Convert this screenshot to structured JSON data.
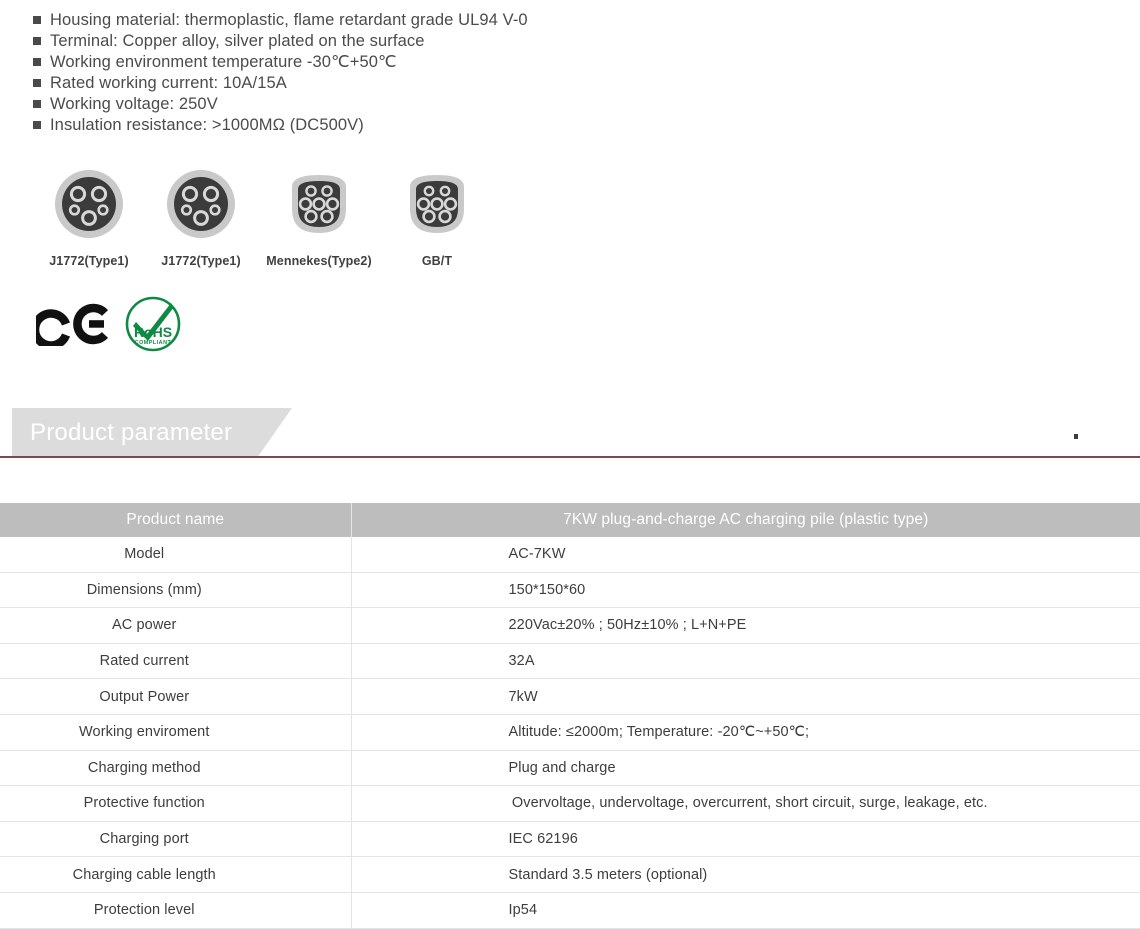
{
  "specs": {
    "bullet_glyph": "square-bullet",
    "items": [
      "Housing material: thermoplastic, flame retardant grade UL94 V-0",
      "Terminal: Copper alloy, silver plated on the surface",
      "Working environment temperature -30℃+50℃",
      "Rated working current: 10A/15A",
      "Working voltage: 250V",
      "Insulation resistance: >1000MΩ (DC500V)"
    ]
  },
  "connectors": [
    {
      "label": "J1772(Type1)",
      "icon": "j1772-type1-connector-icon",
      "shape": "circle",
      "pins": 5
    },
    {
      "label": "J1772(Type1)",
      "icon": "j1772-type1-connector-icon",
      "shape": "circle",
      "pins": 5
    },
    {
      "label": "Mennekes(Type2)",
      "icon": "mennekes-type2-connector-icon",
      "shape": "d-shape",
      "pins": 7
    },
    {
      "label": "GB/T",
      "icon": "gbt-connector-icon",
      "shape": "d-shape",
      "pins": 7
    }
  ],
  "certifications": [
    {
      "name": "ce-mark-logo",
      "label": "CE"
    },
    {
      "name": "rohs-compliant-logo",
      "label": "RoHS",
      "sublabel": "COMPLIANT"
    }
  ],
  "section": {
    "title": "Product parameter",
    "banner_color": "#dcdcdc",
    "rule_color": "#7d4a4a"
  },
  "table": {
    "header": {
      "col1": "Product name",
      "col2": "7KW plug-and-charge AC charging pile (plastic type)",
      "background": "#bdbdbd"
    },
    "rows": [
      {
        "key": "Model",
        "value": "AC-7KW",
        "wide": false
      },
      {
        "key": "Dimensions (mm)",
        "value": "150*150*60",
        "wide": false
      },
      {
        "key": "AC power",
        "value": "220Vac±20% ; 50Hz±10% ; L+N+PE",
        "wide": false
      },
      {
        "key": "Rated current",
        "value": "32A",
        "wide": false
      },
      {
        "key": "Output Power",
        "value": "7kW",
        "wide": false
      },
      {
        "key": "Working enviroment",
        "value": "Altitude: ≤2000m; Temperature: -20℃~+50℃;",
        "wide": false
      },
      {
        "key": "Charging method",
        "value": "Plug and charge",
        "wide": false
      },
      {
        "key": "Protective function",
        "value": "Overvoltage, undervoltage, overcurrent, short circuit, surge, leakage, etc.",
        "wide": true
      },
      {
        "key": "Charging port",
        "value": "IEC   62196",
        "wide": false
      },
      {
        "key": "Charging cable length",
        "value": "Standard 3.5 meters (optional)",
        "wide": false
      },
      {
        "key": "Protection level",
        "value": "Ip54",
        "wide": false
      }
    ]
  }
}
